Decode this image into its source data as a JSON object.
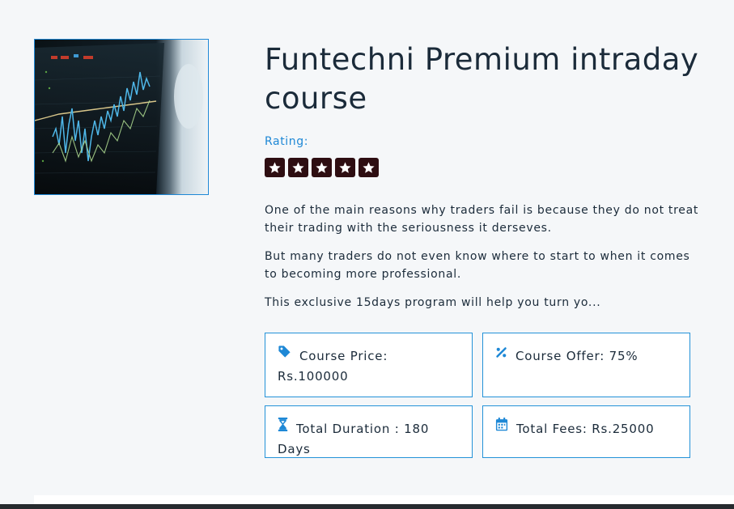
{
  "course": {
    "title": "Funtechni Premium intraday course",
    "image_icon": "stock-chart-image",
    "rating_label": "Rating:",
    "rating": {
      "value": 5,
      "max": 5
    },
    "description": [
      "One of the main reasons why traders fail is because they do not treat their trading with the seriousness it derseves.",
      "But many traders do not even know where to start to when it comes to becoming more professional.",
      "This exclusive 15days  program will help you turn yo..."
    ]
  },
  "details": {
    "price": {
      "icon": "tag-icon",
      "label": "Course Price: Rs.100000"
    },
    "offer": {
      "icon": "percent-icon",
      "label": "Course Offer: 75%"
    },
    "duration": {
      "icon": "hourglass-icon",
      "label": "Total Duration : 180 Days"
    },
    "fees": {
      "icon": "calendar-icon",
      "label": "Total Fees: Rs.25000"
    }
  },
  "colors": {
    "accent": "#1e88d6",
    "star_bg": "#2e0e12",
    "title": "#1b2b3a",
    "page_bg": "#f5f7f9"
  }
}
